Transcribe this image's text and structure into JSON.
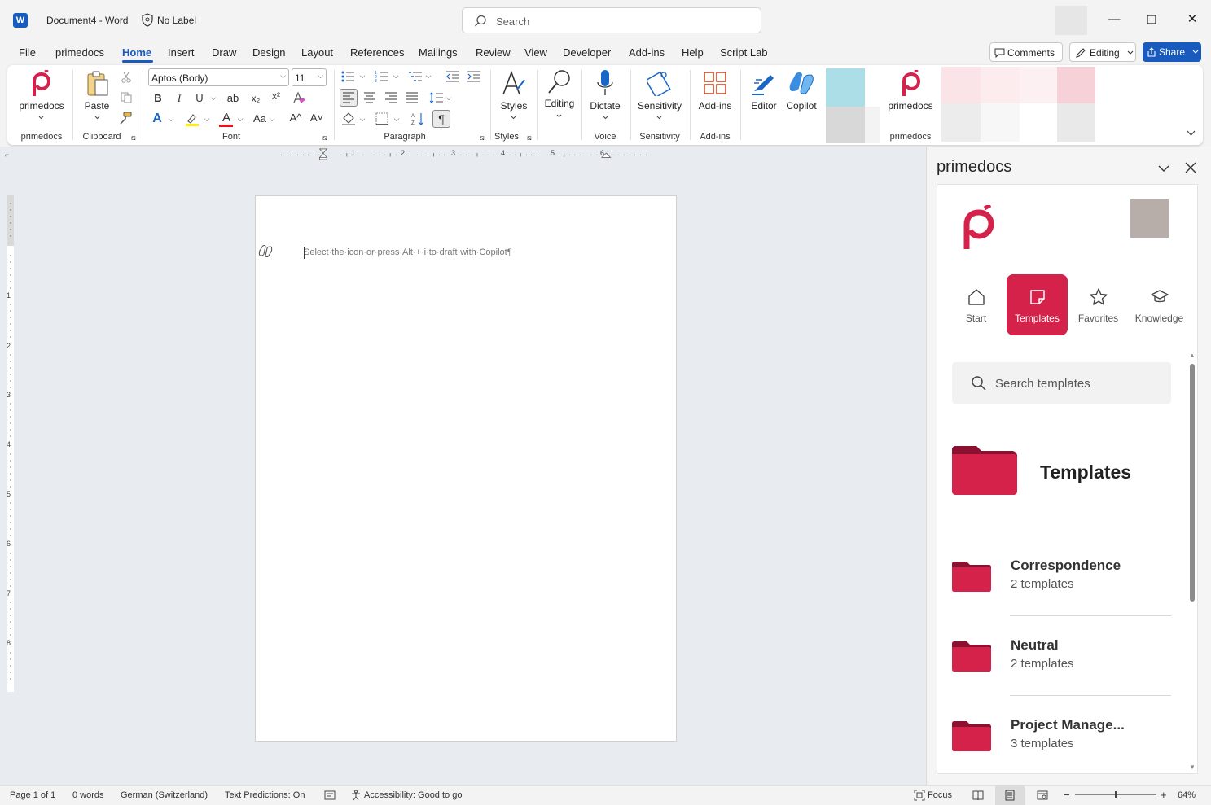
{
  "titlebar": {
    "app_icon": "word-logo",
    "doc_title": "Document4  -  Word",
    "label_text": "No Label",
    "search_placeholder": "Search"
  },
  "menu": {
    "tabs": [
      "File",
      "primedocs",
      "Home",
      "Insert",
      "Draw",
      "Design",
      "Layout",
      "References",
      "Mailings",
      "Review",
      "View",
      "Developer",
      "Add-ins",
      "Help",
      "Script Lab"
    ],
    "active_tab": "Home",
    "comments": "Comments",
    "editing": "Editing",
    "share": "Share"
  },
  "ribbon": {
    "primedocs_btn": "primedocs",
    "paste_btn": "Paste",
    "font_name": "Aptos (Body)",
    "font_size": "11",
    "styles_btn": "Styles",
    "editing_btn": "Editing",
    "dictate_btn": "Dictate",
    "sensitivity_btn": "Sensitivity",
    "addins_btn": "Add-ins",
    "editor_btn": "Editor",
    "copilot_btn": "Copilot",
    "primedocs_btn2": "primedocs",
    "groups": {
      "primedocs": "primedocs",
      "clipboard": "Clipboard",
      "font": "Font",
      "paragraph": "Paragraph",
      "styles": "Styles",
      "voice": "Voice",
      "sensitivity": "Sensitivity",
      "addins": "Add-ins",
      "primedocs2": "primedocs"
    },
    "font_btns": {
      "bold": "B",
      "italic": "I",
      "underline": "U",
      "strike": "ab",
      "subscript": "x₂",
      "superscript": "x²",
      "change_case": "Aa",
      "grow": "A^",
      "shrink": "A˅"
    }
  },
  "ruler": {
    "h_labels": [
      "1",
      "2",
      "3",
      "4",
      "5",
      "6"
    ],
    "v_labels": [
      "1",
      "2",
      "3",
      "4",
      "5",
      "6",
      "7",
      "8"
    ]
  },
  "document": {
    "hint": "Select·the·icon·or·press·Alt·+·i·to·draft·with·Copilot¶"
  },
  "pane": {
    "title": "primedocs",
    "nav": [
      {
        "label": "Start",
        "icon": "home-icon"
      },
      {
        "label": "Templates",
        "icon": "templates-icon",
        "active": true
      },
      {
        "label": "Favorites",
        "icon": "star-icon"
      },
      {
        "label": "Knowledge",
        "icon": "graduation-cap-icon"
      }
    ],
    "search_placeholder": "Search templates",
    "section_title": "Templates",
    "folders": [
      {
        "name": "Correspondence",
        "count": "2 templates"
      },
      {
        "name": "Neutral",
        "count": "2 templates"
      },
      {
        "name": "Project Manage...",
        "count": "3 templates"
      }
    ],
    "brand_color": "#d5224b"
  },
  "statusbar": {
    "page": "Page 1 of 1",
    "words": "0 words",
    "language": "German (Switzerland)",
    "predictions": "Text Predictions: On",
    "accessibility": "Accessibility: Good to go",
    "focus": "Focus",
    "zoom": "64%"
  }
}
